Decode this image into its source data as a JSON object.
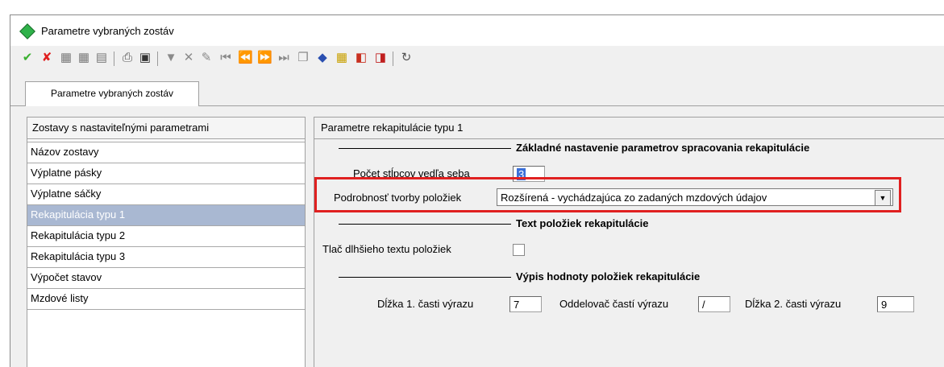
{
  "window": {
    "title": "Parametre vybraných zostáv"
  },
  "toolbar": {
    "icons": [
      {
        "name": "confirm-icon",
        "glyph": "✔",
        "color": "#3ab030"
      },
      {
        "name": "cancel-icon",
        "glyph": "✘",
        "color": "#e02020"
      }
    ]
  },
  "tab": {
    "label": "Parametre vybraných zostáv"
  },
  "left_panel": {
    "title": "Zostavy s nastaviteľnými parametrami",
    "items": [
      "Názov zostavy",
      "Výplatne pásky",
      "Výplatne sáčky",
      "Rekapitulácia typu 1",
      "Rekapitulácia typu 2",
      "Rekapitulácia typu 3",
      "Výpočet stavov",
      "Mzdové listy"
    ],
    "selected": "Rekapitulácia typu 1"
  },
  "right_panel": {
    "title": "Parametre rekapitulácie typu 1",
    "section1": "Základné nastavenie parametrov spracovania rekapitulácie",
    "columns_label": "Počet stĺpcov vedľa seba",
    "columns_value": "3",
    "detail_label": "Podrobnosť tvorby položiek",
    "detail_value": "Rozšírená - vychádzajúca zo zadaných mzdových údajov",
    "section2": "Text položiek rekapitulácie",
    "longtext_label": "Tlač dlhšieho textu položiek",
    "section3": "Výpis hodnoty položiek rekapitulácie",
    "len1_label": "Dĺžka 1. časti výrazu",
    "len1_value": "7",
    "sep_label": "Oddelovač častí výrazu",
    "sep_value": "/",
    "len2_label": "Dĺžka 2. časti výrazu",
    "len2_value": "9"
  }
}
